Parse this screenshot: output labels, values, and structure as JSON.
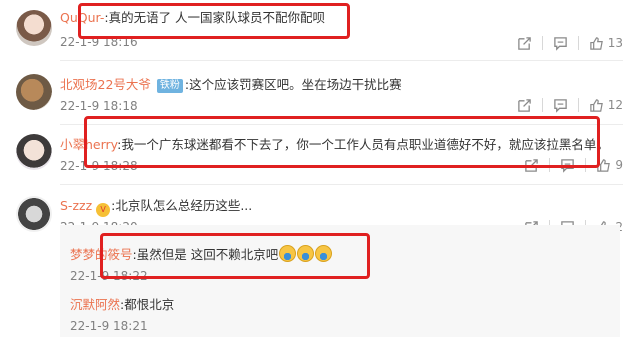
{
  "comments": [
    {
      "user": "QuQur-",
      "text": ":真的无语了 人一国家队球员不配你配呗",
      "time": "22-1-9 18:16",
      "likes": "13"
    },
    {
      "user": "北观场22号大爷",
      "badge": "铁粉",
      "text": ":这个应该罚赛区吧。坐在场边干扰比赛",
      "time": "22-1-9 18:18",
      "likes": "12"
    },
    {
      "user": "小翠herry",
      "text": ":我一个广东球迷都看不下去了，你一个工作人员有点职业道德好不好，就应该拉黑名单。",
      "time": "22-1-9 18:28",
      "likes": "9"
    },
    {
      "user": "S-zzz",
      "text": ":北京队怎么总经历这些...",
      "time": "22-1-9 18:20",
      "likes": "2"
    }
  ],
  "replies": [
    {
      "user": "梦梦的筱号",
      "text": ":虽然但是 这回不赖北京吧",
      "time": "22-1-9 18:22"
    },
    {
      "user": "沉默阿然",
      "text": ":都恨北京",
      "time": "22-1-9 18:21"
    }
  ],
  "icons": {
    "share": "share-icon",
    "comment": "comment-icon",
    "like": "thumbs-up-icon"
  },
  "colors": {
    "username": "#eb7350",
    "highlight": "#e02020",
    "reply_bg": "#f7f7f7"
  }
}
